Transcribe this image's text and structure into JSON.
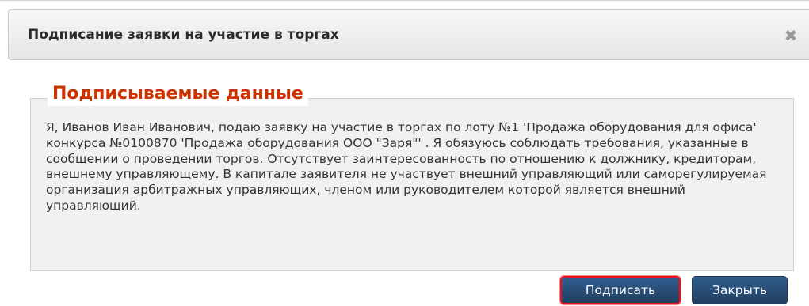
{
  "dialog": {
    "title": "Подписание заявки на участие в торгах",
    "close_glyph": "✖"
  },
  "fieldset": {
    "legend": "Подписываемые данные",
    "text": "Я, Иванов Иван Иванович, подаю заявку на участие в торгах по лоту №1 'Продажа оборудования для офиса' конкурса №0100870 'Продажа оборудования ООО \"Заря\"' . Я обязуюсь соблюдать требования, указанные в сообщении о проведении торгов. Отсутствует заинтересованность по отношению к должнику, кредиторам, внешнему управляющему. В капитале заявителя не участвует внешний управляющий или саморегулируемая организация арбитражных управляющих, членом или руководителем которой является внешний управляющий."
  },
  "buttons": {
    "sign_label": "Подписать",
    "close_label": "Закрыть"
  },
  "colors": {
    "legend": "#cc3300",
    "button": "#2a4f78",
    "sign_highlight": "#e0141e"
  }
}
